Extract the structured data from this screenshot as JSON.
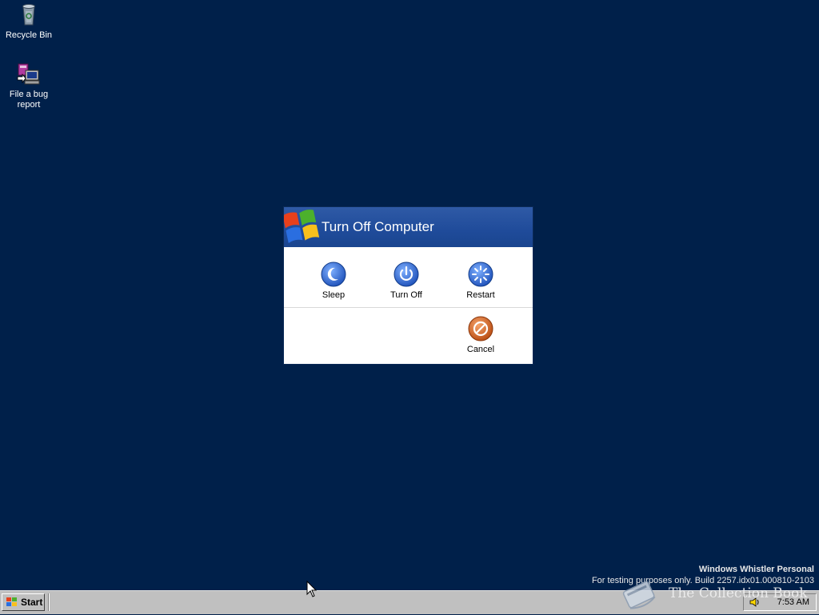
{
  "desktop": {
    "icons": [
      {
        "label": "Recycle Bin",
        "icon": "recycle-bin-icon"
      },
      {
        "label": "File a bug report",
        "icon": "bug-report-icon"
      }
    ],
    "background_color": "#00204a"
  },
  "dialog": {
    "title": "Turn Off Computer",
    "actions": [
      {
        "label": "Sleep",
        "icon": "sleep-moon-icon",
        "color": "#2e6ad8"
      },
      {
        "label": "Turn Off",
        "icon": "power-icon",
        "color": "#2e6ad8"
      },
      {
        "label": "Restart",
        "icon": "restart-icon",
        "color": "#2e6ad8"
      }
    ],
    "cancel": {
      "label": "Cancel",
      "icon": "cancel-icon",
      "color": "#d4621c"
    }
  },
  "watermark": {
    "title": "Windows Whistler Personal",
    "subtitle": "For testing purposes only. Build 2257.idx01.000810-2103"
  },
  "taskbar": {
    "start_label": "Start",
    "clock": "7:53 AM",
    "speaker_icon": "speaker-icon"
  },
  "brand_overlay": {
    "text": "The Collection Book",
    "icon": "book-icon"
  }
}
